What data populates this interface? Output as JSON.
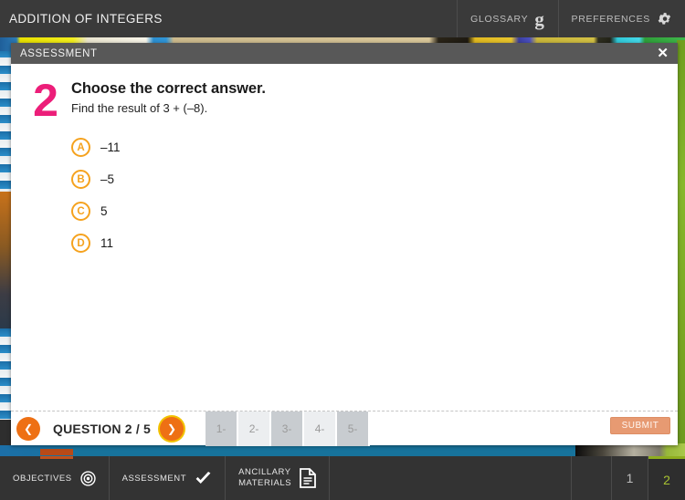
{
  "header": {
    "title": "ADDITION OF INTEGERS",
    "buttons": [
      {
        "label": "GLOSSARY",
        "icon": "glossary-g-icon"
      },
      {
        "label": "PREFERENCES",
        "icon": "gear-icon"
      }
    ]
  },
  "modal": {
    "title": "ASSESSMENT",
    "close_label": "✕"
  },
  "question": {
    "number": "2",
    "prompt": "Choose the correct answer.",
    "subprompt": "Find the result of 3 + (–8).",
    "options": [
      {
        "letter": "A",
        "text": "–11"
      },
      {
        "letter": "B",
        "text": "–5"
      },
      {
        "letter": "C",
        "text": "5"
      },
      {
        "letter": "D",
        "text": "11"
      }
    ]
  },
  "nav": {
    "prev_icon": "❮",
    "next_icon": "❯",
    "question_label": "QUESTION 2 / 5",
    "tabs": [
      {
        "label": "1-",
        "style": "dark"
      },
      {
        "label": "2-",
        "style": "light"
      },
      {
        "label": "3-",
        "style": "dark"
      },
      {
        "label": "4-",
        "style": "light"
      },
      {
        "label": "5-",
        "style": "dark"
      }
    ],
    "submit_label": "SUBMIT"
  },
  "bottombar": {
    "items": [
      {
        "label": "OBJECTIVES",
        "icon": "target-icon"
      },
      {
        "label": "ASSESSMENT",
        "icon": "check-icon"
      },
      {
        "label_line1": "ANCILLARY",
        "label_line2": "MATERIALS",
        "icon": "document-icon"
      }
    ],
    "pages": [
      {
        "label": "1",
        "active": false
      },
      {
        "label": "2",
        "active": true
      }
    ]
  },
  "colors": {
    "accent_orange": "#ee7014",
    "bubble_orange": "#f5a21e",
    "question_pink": "#ec1e79",
    "active_page_green": "#a8c232",
    "submit_disabled": "#e79a72"
  }
}
